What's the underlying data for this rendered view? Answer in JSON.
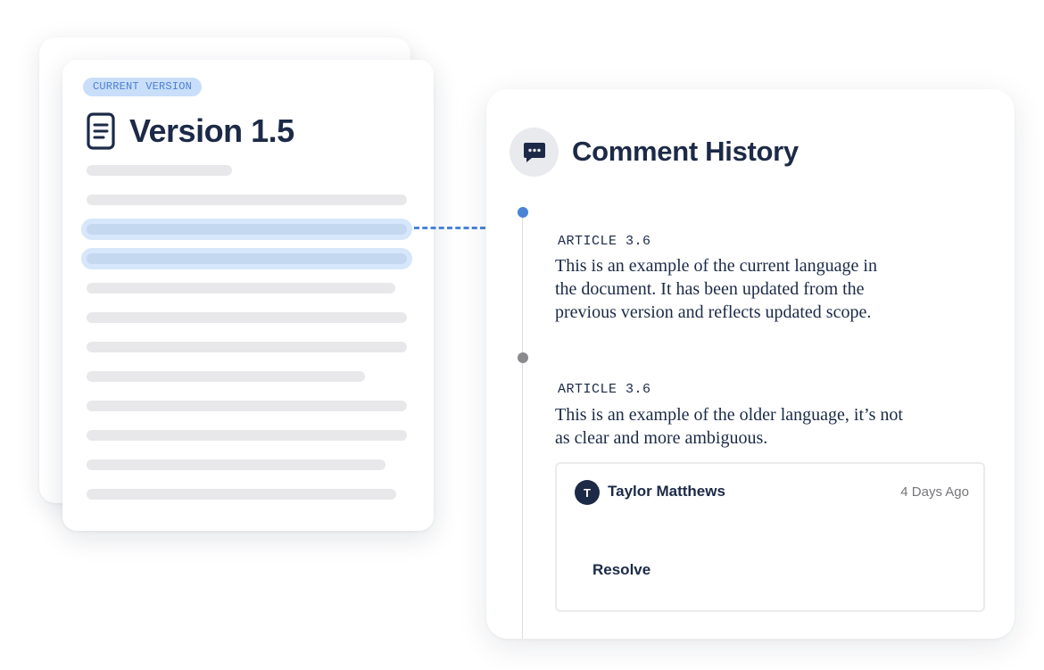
{
  "document": {
    "badge": "CURRENT VERSION",
    "title": "Version 1.5",
    "icon": "document-icon"
  },
  "comment_history": {
    "title": "Comment History",
    "icon": "chat-bubble-icon",
    "entries": [
      {
        "article": "ARTICLE 3.6",
        "text_lines": [
          "This is an example of the current language in",
          "the document. It has been updated from the",
          "previous version and reflects updated scope."
        ],
        "status_color": "#4a84d8"
      },
      {
        "article": "ARTICLE 3.6",
        "text_lines": [
          "This is an example of the older language, it’s not",
          "as clear and more ambiguous."
        ],
        "status_color": "#8b8b8f"
      }
    ],
    "comment": {
      "avatar_initial": "T",
      "author": "Taylor Matthews",
      "time": "4 Days Ago",
      "action_label": "Resolve"
    }
  },
  "colors": {
    "accent": "#4a84d8",
    "text": "#1c2a47",
    "badge_bg": "#c8def9",
    "highlight": "#c4d8f0"
  }
}
